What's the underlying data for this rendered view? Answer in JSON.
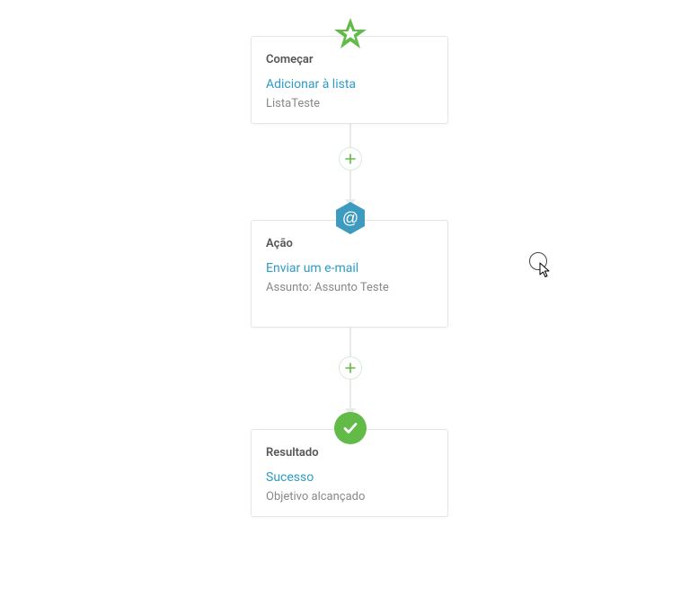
{
  "colors": {
    "green": "#61bb46",
    "teal": "#2e9bc6",
    "line": "#e9e9e9",
    "text_muted": "#888888"
  },
  "nodes": {
    "start": {
      "header": "Começar",
      "title": "Adicionar à lista",
      "sub": "ListaTeste"
    },
    "action": {
      "header": "Ação",
      "title": "Enviar um e-mail",
      "sub": "Assunto: Assunto Teste"
    },
    "result": {
      "header": "Resultado",
      "title": "Sucesso",
      "sub": "Objetivo alcançado"
    }
  }
}
